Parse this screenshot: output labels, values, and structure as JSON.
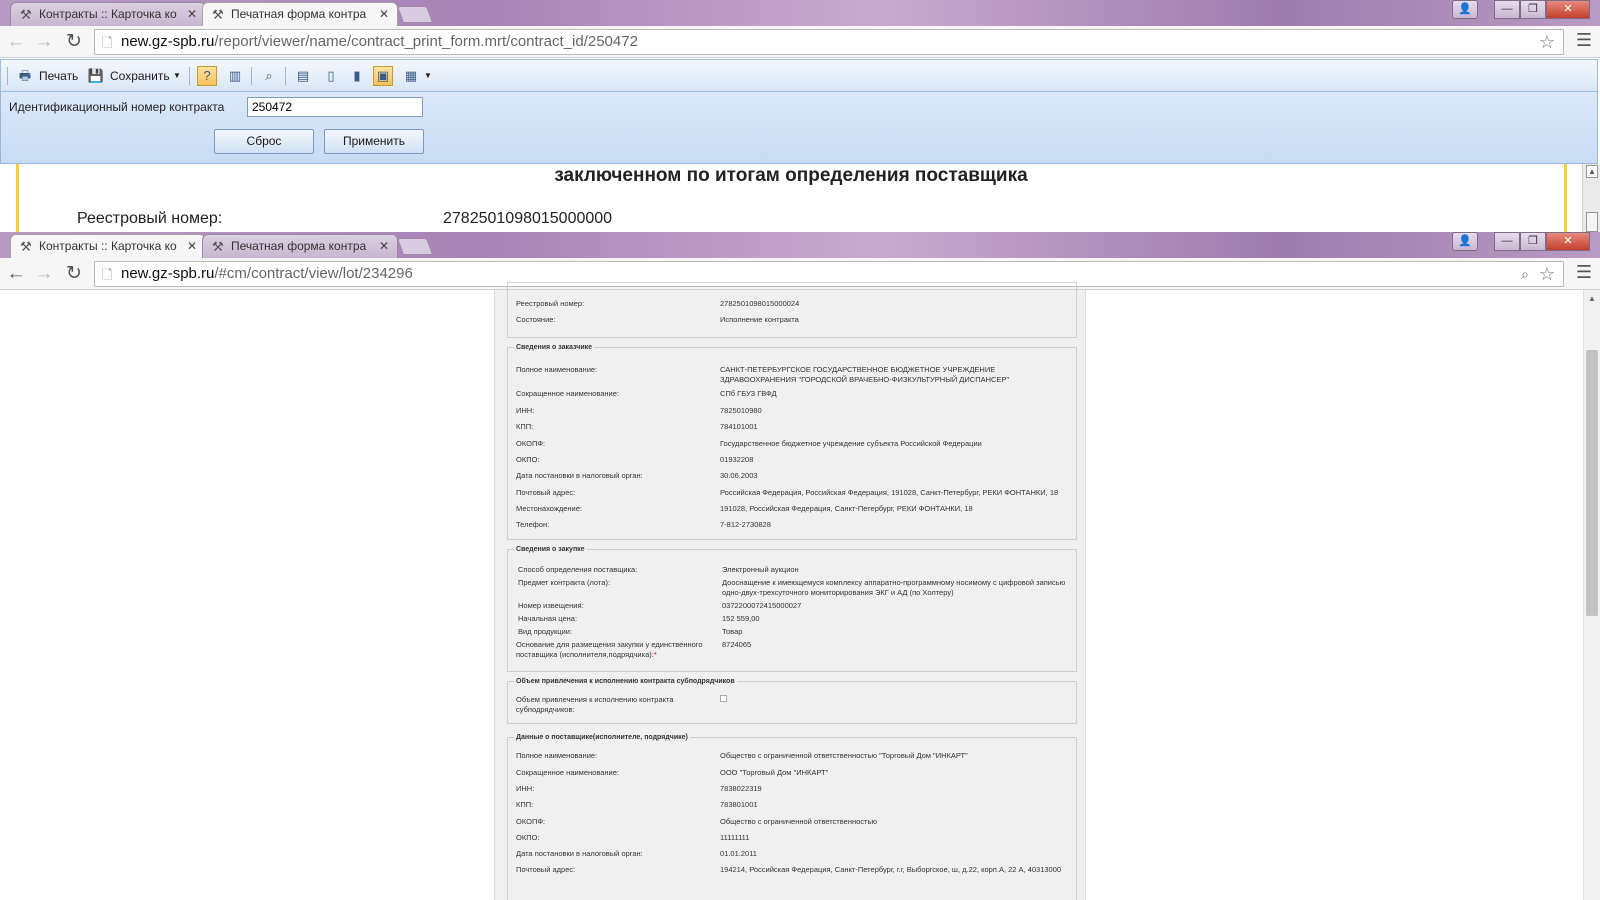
{
  "top_window": {
    "tabs": [
      {
        "title": "Контракты :: Карточка ко",
        "active": false
      },
      {
        "title": "Печатная форма контра",
        "active": true
      }
    ],
    "url": {
      "host": "new.gz-spb.ru",
      "path": "/report/viewer/name/contract_print_form.mrt/contract_id/250472"
    },
    "toolbar": {
      "print": "Печать",
      "save": "Сохранить"
    },
    "params": {
      "label": "Идентификационный номер контракта",
      "value": "250472",
      "reset": "Сброс",
      "apply": "Применить"
    },
    "page": {
      "heading": "заключенном по итогам определения поставщика",
      "reg_label": "Реестровый номер:",
      "reg_value": "2782501098015000000"
    }
  },
  "bottom_window": {
    "tabs": [
      {
        "title": "Контракты :: Карточка ко",
        "active": true
      },
      {
        "title": "Печатная форма контра",
        "active": false
      }
    ],
    "url": {
      "host": "new.gz-spb.ru",
      "path": "/#cm/contract/view/lot/234296"
    },
    "contract": {
      "registry": [
        {
          "k": "Реестровый номер:",
          "v": "2782501098015000024"
        },
        {
          "k": "Состояние:",
          "v": "Исполнение контракта"
        }
      ],
      "customer": {
        "legend": "Сведения о заказчике",
        "rows": [
          {
            "k": "Полное наименование:",
            "v": "САНКТ-ПЕТЕРБУРГСКОЕ ГОСУДАРСТВЕННОЕ БЮДЖЕТНОЕ УЧРЕЖДЕНИЕ ЗДРАВООХРАНЕНИЯ \"ГОРОДСКОЙ ВРАЧЕБНО-ФИЗКУЛЬТУРНЫЙ ДИСПАНСЕР\""
          },
          {
            "k": "Сокращенное наименование:",
            "v": "СПб ГБУЗ ГВФД"
          },
          {
            "k": "ИНН:",
            "v": "7825010980"
          },
          {
            "k": "КПП:",
            "v": "784101001"
          },
          {
            "k": "ОКОПФ:",
            "v": "Государственное бюджетное учреждение субъекта Российской Федерации"
          },
          {
            "k": "ОКПО:",
            "v": "01932208"
          },
          {
            "k": "Дата постановки в налоговый орган:",
            "v": "30.06.2003"
          },
          {
            "k": "Почтовый адрес:",
            "v": "Российская Федерация, Российская Федерация, 191028, Санкт-Петербург, РЕКИ ФОНТАНКИ, 18"
          },
          {
            "k": "Местонахождение:",
            "v": "191028, Российская Федерация, Санкт-Петербург, РЕКИ ФОНТАНКИ, 18"
          },
          {
            "k": "Телефон:",
            "v": "7-812-2730828"
          }
        ]
      },
      "purchase": {
        "legend": "Сведения о закупке",
        "rows": [
          {
            "k": "Способ определения поставщика:",
            "v": "Электронный аукцион"
          },
          {
            "k": "Предмет контракта (лота):",
            "v": "Дооснащение к имеющемуся комплексу аппаратно-программному носимому с цифровой записью одно-двух-трехсуточного мониторирования ЭКГ и АД (по Холтеру)"
          },
          {
            "k": "Номер извещения:",
            "v": "0372200072415000027"
          },
          {
            "k": "Начальная цена:",
            "v": "152 559,00"
          },
          {
            "k": "Вид продукции:",
            "v": "Товар"
          },
          {
            "k": "Основание для размещения закупки у единственного поставщика (исполнителя,подрядчика):",
            "v": "8724065"
          }
        ]
      },
      "subcontract": {
        "legend": "Объем привлечения к исполнению контракта субподрядчиков",
        "label": "Объем привлечения к исполнению контракта субподрядчиков:"
      },
      "supplier": {
        "legend": "Данные о поставщике(исполнителе, подрядчике)",
        "rows": [
          {
            "k": "Полное наименование:",
            "v": "Общество с ограниченной ответственностью \"Торговый Дом \"ИНКАРТ\""
          },
          {
            "k": "Сокращенное наименование:",
            "v": "ООО \"Торговый Дом \"ИНКАРТ\""
          },
          {
            "k": "ИНН:",
            "v": "7838022319"
          },
          {
            "k": "КПП:",
            "v": "783801001"
          },
          {
            "k": "ОКОПФ:",
            "v": "Общество с ограниченной ответственностью"
          },
          {
            "k": "ОКПО:",
            "v": "11111111"
          },
          {
            "k": "Дата постановки в налоговый орган:",
            "v": "01.01.2011"
          },
          {
            "k": "Почтовый адрес:",
            "v": "194214, Российская Федерация, Санкт-Петербург, г.г, Выборгское, ш, д.22, корп.А, 22 А, 40313000"
          }
        ]
      }
    }
  }
}
